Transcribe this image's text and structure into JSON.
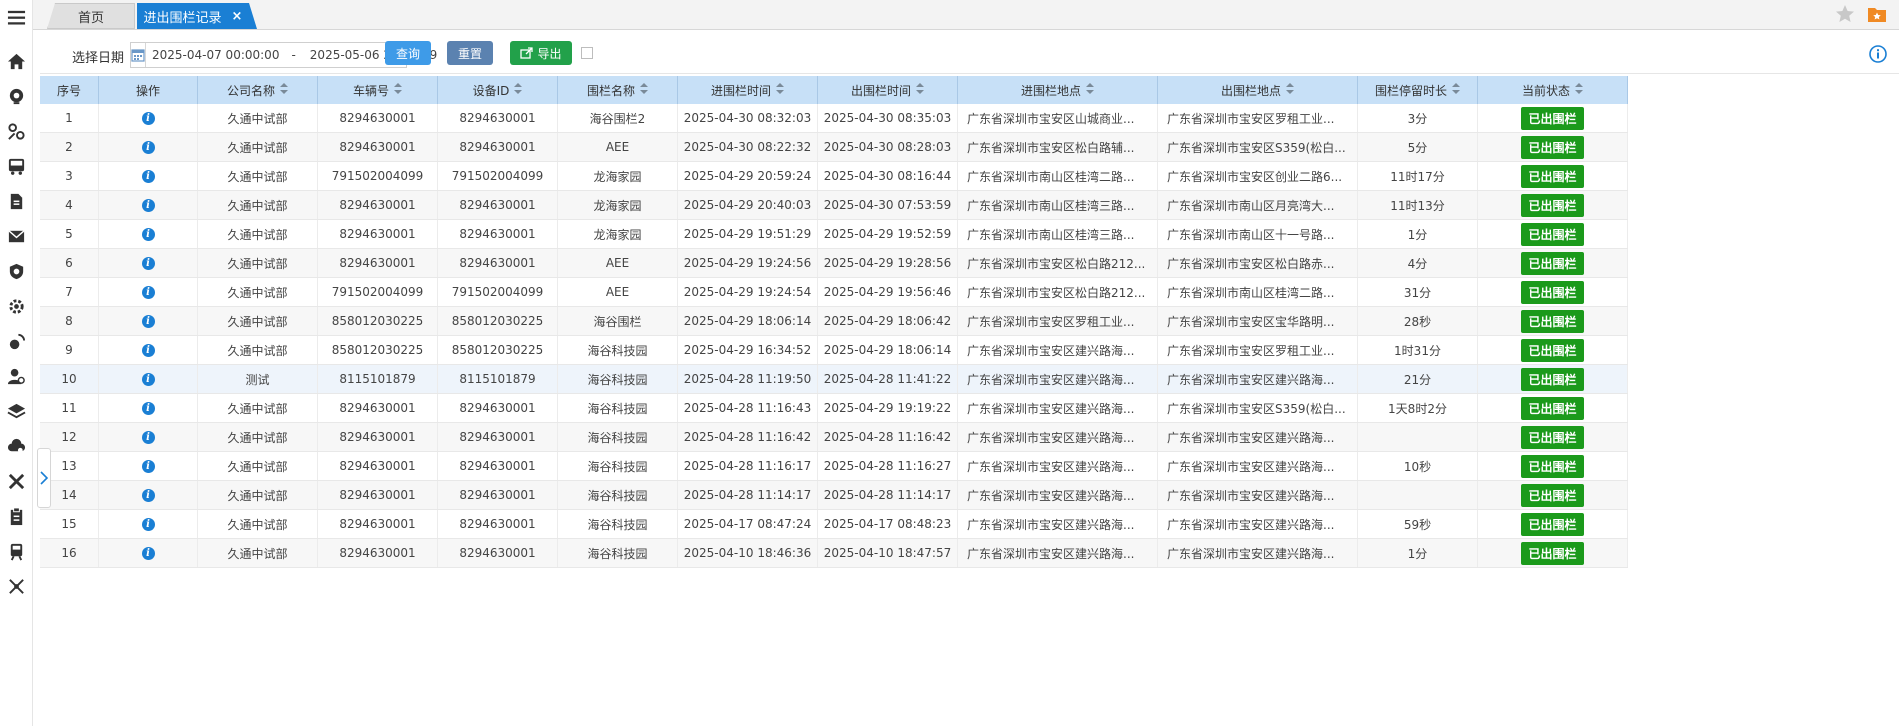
{
  "sidebar": {
    "icons": [
      "menu-icon",
      "home-icon",
      "map-pin-icon",
      "route-icon",
      "bus-icon",
      "document-icon",
      "mail-icon",
      "shield-icon",
      "settings-icon",
      "broadcast-icon",
      "user-gear-icon",
      "layers-icon",
      "cloud-gear-icon",
      "tools-icon",
      "clipboard-icon",
      "train-icon",
      "network-icon"
    ]
  },
  "tabs": {
    "home": "首页",
    "active": "进出围栏记录",
    "close": "×"
  },
  "toolbar": {
    "date_label": "选择日期",
    "date_start": "2025-04-07 00:00:00",
    "date_sep": "-",
    "date_end": "2025-05-06 23:59:59",
    "query": "查询",
    "reset": "重置",
    "export": "导出"
  },
  "table": {
    "headers": [
      "序号",
      "操作",
      "公司名称",
      "车辆号",
      "设备ID",
      "围栏名称",
      "进围栏时间",
      "出围栏时间",
      "进围栏地点",
      "出围栏地点",
      "围栏停留时长",
      "当前状态"
    ],
    "rows": [
      [
        "1",
        "",
        "久通中试部",
        "8294630001",
        "8294630001",
        "海谷围栏2",
        "2025-04-30 08:32:03",
        "2025-04-30 08:35:03",
        "广东省深圳市宝安区山城商业...",
        "广东省深圳市宝安区罗租工业...",
        "3分",
        "已出围栏"
      ],
      [
        "2",
        "",
        "久通中试部",
        "8294630001",
        "8294630001",
        "AEE",
        "2025-04-30 08:22:32",
        "2025-04-30 08:28:03",
        "广东省深圳市宝安区松白路辅...",
        "广东省深圳市宝安区S359(松白...",
        "5分",
        "已出围栏"
      ],
      [
        "3",
        "",
        "久通中试部",
        "791502004099",
        "791502004099",
        "龙海家园",
        "2025-04-29 20:59:24",
        "2025-04-30 08:16:44",
        "广东省深圳市南山区桂湾二路...",
        "广东省深圳市宝安区创业二路6...",
        "11时17分",
        "已出围栏"
      ],
      [
        "4",
        "",
        "久通中试部",
        "8294630001",
        "8294630001",
        "龙海家园",
        "2025-04-29 20:40:03",
        "2025-04-30 07:53:59",
        "广东省深圳市南山区桂湾三路...",
        "广东省深圳市南山区月亮湾大...",
        "11时13分",
        "已出围栏"
      ],
      [
        "5",
        "",
        "久通中试部",
        "8294630001",
        "8294630001",
        "龙海家园",
        "2025-04-29 19:51:29",
        "2025-04-29 19:52:59",
        "广东省深圳市南山区桂湾三路...",
        "广东省深圳市南山区十一号路...",
        "1分",
        "已出围栏"
      ],
      [
        "6",
        "",
        "久通中试部",
        "8294630001",
        "8294630001",
        "AEE",
        "2025-04-29 19:24:56",
        "2025-04-29 19:28:56",
        "广东省深圳市宝安区松白路212...",
        "广东省深圳市宝安区松白路赤...",
        "4分",
        "已出围栏"
      ],
      [
        "7",
        "",
        "久通中试部",
        "791502004099",
        "791502004099",
        "AEE",
        "2025-04-29 19:24:54",
        "2025-04-29 19:56:46",
        "广东省深圳市宝安区松白路212...",
        "广东省深圳市南山区桂湾二路...",
        "31分",
        "已出围栏"
      ],
      [
        "8",
        "",
        "久通中试部",
        "858012030225",
        "858012030225",
        "海谷围栏",
        "2025-04-29 18:06:14",
        "2025-04-29 18:06:42",
        "广东省深圳市宝安区罗租工业...",
        "广东省深圳市宝安区宝华路明...",
        "28秒",
        "已出围栏"
      ],
      [
        "9",
        "",
        "久通中试部",
        "858012030225",
        "858012030225",
        "海谷科技园",
        "2025-04-29 16:34:52",
        "2025-04-29 18:06:14",
        "广东省深圳市宝安区建兴路海...",
        "广东省深圳市宝安区罗租工业...",
        "1时31分",
        "已出围栏"
      ],
      [
        "10",
        "",
        "测试",
        "8115101879",
        "8115101879",
        "海谷科技园",
        "2025-04-28 11:19:50",
        "2025-04-28 11:41:22",
        "广东省深圳市宝安区建兴路海...",
        "广东省深圳市宝安区建兴路海...",
        "21分",
        "已出围栏"
      ],
      [
        "11",
        "",
        "久通中试部",
        "8294630001",
        "8294630001",
        "海谷科技园",
        "2025-04-28 11:16:43",
        "2025-04-29 19:19:22",
        "广东省深圳市宝安区建兴路海...",
        "广东省深圳市宝安区S359(松白...",
        "1天8时2分",
        "已出围栏"
      ],
      [
        "12",
        "",
        "久通中试部",
        "8294630001",
        "8294630001",
        "海谷科技园",
        "2025-04-28 11:16:42",
        "2025-04-28 11:16:42",
        "广东省深圳市宝安区建兴路海...",
        "广东省深圳市宝安区建兴路海...",
        "",
        "已出围栏"
      ],
      [
        "13",
        "",
        "久通中试部",
        "8294630001",
        "8294630001",
        "海谷科技园",
        "2025-04-28 11:16:17",
        "2025-04-28 11:16:27",
        "广东省深圳市宝安区建兴路海...",
        "广东省深圳市宝安区建兴路海...",
        "10秒",
        "已出围栏"
      ],
      [
        "14",
        "",
        "久通中试部",
        "8294630001",
        "8294630001",
        "海谷科技园",
        "2025-04-28 11:14:17",
        "2025-04-28 11:14:17",
        "广东省深圳市宝安区建兴路海...",
        "广东省深圳市宝安区建兴路海...",
        "",
        "已出围栏"
      ],
      [
        "15",
        "",
        "久通中试部",
        "8294630001",
        "8294630001",
        "海谷科技园",
        "2025-04-17 08:47:24",
        "2025-04-17 08:48:23",
        "广东省深圳市宝安区建兴路海...",
        "广东省深圳市宝安区建兴路海...",
        "59秒",
        "已出围栏"
      ],
      [
        "16",
        "",
        "久通中试部",
        "8294630001",
        "8294630001",
        "海谷科技园",
        "2025-04-10 18:46:36",
        "2025-04-10 18:47:57",
        "广东省深圳市宝安区建兴路海...",
        "广东省深圳市宝安区建兴路海...",
        "1分",
        "已出围栏"
      ]
    ]
  },
  "colors": {
    "accent": "#1a7fd4",
    "header_bg": "#c7e0f7",
    "status_green": "#1b9a1b",
    "export_green": "#22a14a",
    "reset_blue": "#5b82b0"
  }
}
